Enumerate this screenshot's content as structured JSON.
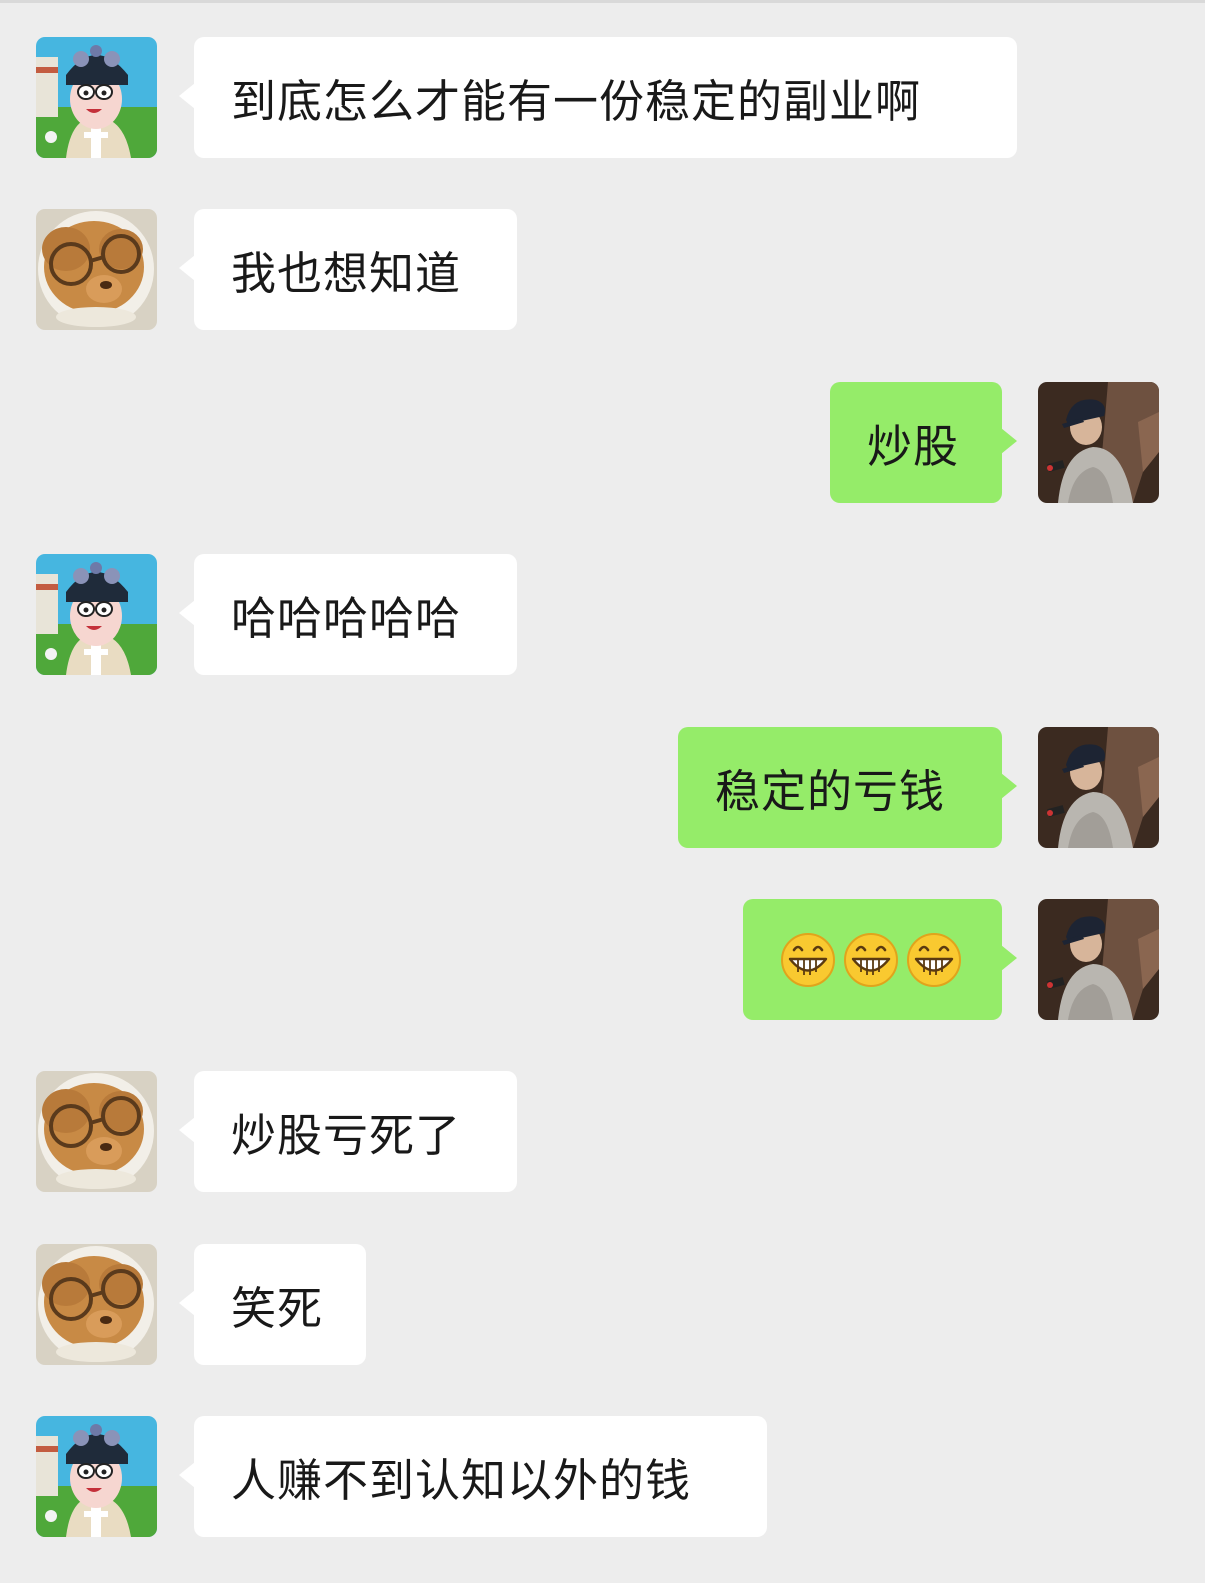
{
  "colors": {
    "background": "#ededed",
    "incoming_bubble": "#ffffff",
    "outgoing_bubble": "#95ec69",
    "text": "#191919"
  },
  "messages": [
    {
      "side": "left",
      "avatar": "qing-lady-avatar",
      "text": "到底怎么才能有一份稳定的副业啊"
    },
    {
      "side": "left",
      "avatar": "glasses-bear-avatar",
      "text": "我也想知道"
    },
    {
      "side": "right",
      "avatar": "cap-person-avatar",
      "text": "炒股"
    },
    {
      "side": "left",
      "avatar": "qing-lady-avatar",
      "text": "哈哈哈哈哈"
    },
    {
      "side": "right",
      "avatar": "cap-person-avatar",
      "text": "稳定的亏钱"
    },
    {
      "side": "right",
      "avatar": "cap-person-avatar",
      "emoji": [
        "grin-emoji",
        "grin-emoji",
        "grin-emoji"
      ]
    },
    {
      "side": "left",
      "avatar": "glasses-bear-avatar",
      "text": "炒股亏死了"
    },
    {
      "side": "left",
      "avatar": "glasses-bear-avatar",
      "text": "笑死"
    },
    {
      "side": "left",
      "avatar": "qing-lady-avatar",
      "text": "人赚不到认知以外的钱"
    }
  ]
}
